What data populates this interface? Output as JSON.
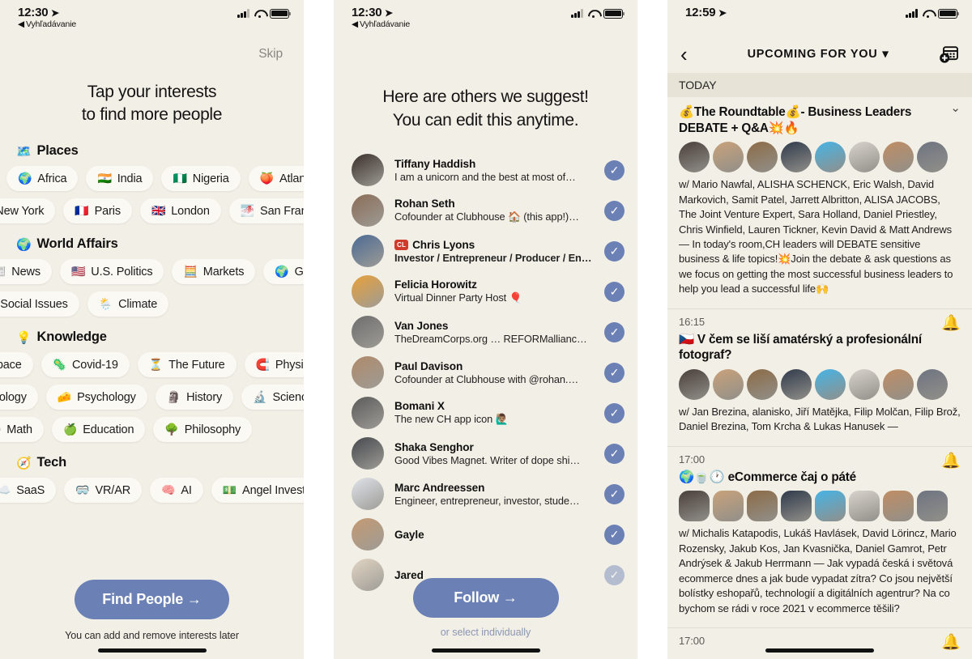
{
  "panel1": {
    "status": {
      "time": "12:30",
      "back_label": "Vyhľadávanie",
      "location_icon": "location-arrow-icon"
    },
    "skip_label": "Skip",
    "headline_line1": "Tap your interests",
    "headline_line2": "to find more people",
    "sections": [
      {
        "emoji": "🗺️",
        "title": "Places",
        "rows": [
          {
            "indent": "ind0",
            "pills": [
              {
                "emoji": "🌍",
                "label": "Africa"
              },
              {
                "emoji": "🇮🇳",
                "label": "India"
              },
              {
                "emoji": "🇳🇬",
                "label": "Nigeria"
              },
              {
                "emoji": "🍑",
                "label": "Atlanta"
              }
            ]
          },
          {
            "indent": "ind2",
            "pills": [
              {
                "emoji": "🗽",
                "label": "New York"
              },
              {
                "emoji": "🇫🇷",
                "label": "Paris"
              },
              {
                "emoji": "🇬🇧",
                "label": "London"
              },
              {
                "emoji": "🌁",
                "label": "San Francisco"
              }
            ]
          }
        ]
      },
      {
        "emoji": "🌍",
        "title": "World Affairs",
        "rows": [
          {
            "indent": "ind5",
            "pills": [
              {
                "emoji": "📰",
                "label": "News"
              },
              {
                "emoji": "🇺🇸",
                "label": "U.S. Politics"
              },
              {
                "emoji": "🧮",
                "label": "Markets"
              },
              {
                "emoji": "🌍",
                "label": "Geopolitics"
              }
            ]
          },
          {
            "indent": "ind6",
            "pills": [
              {
                "emoji": "👥",
                "label": "Social Issues"
              },
              {
                "emoji": "🌦️",
                "label": "Climate"
              }
            ]
          }
        ]
      },
      {
        "emoji": "💡",
        "title": "Knowledge",
        "rows": [
          {
            "indent": "ind4",
            "pills": [
              {
                "emoji": "🚀",
                "label": "Space"
              },
              {
                "emoji": "🦠",
                "label": "Covid-19"
              },
              {
                "emoji": "⏳",
                "label": "The Future"
              },
              {
                "emoji": "🧲",
                "label": "Physics"
              }
            ]
          },
          {
            "indent": "ind4",
            "pills": [
              {
                "emoji": "🧬",
                "label": "Biology"
              },
              {
                "emoji": "🧀",
                "label": "Psychology"
              },
              {
                "emoji": "🗿",
                "label": "History"
              },
              {
                "emoji": "🔬",
                "label": "Science"
              }
            ]
          },
          {
            "indent": "ind3",
            "pills": [
              {
                "emoji": "➗",
                "label": "Math"
              },
              {
                "emoji": "🍏",
                "label": "Education"
              },
              {
                "emoji": "🌳",
                "label": "Philosophy"
              }
            ]
          }
        ]
      },
      {
        "emoji": "🧭",
        "title": "Tech",
        "rows": [
          {
            "indent": "ind1",
            "pills": [
              {
                "emoji": "☁️",
                "label": "SaaS"
              },
              {
                "emoji": "🥽",
                "label": "VR/AR"
              },
              {
                "emoji": "🧠",
                "label": "AI"
              },
              {
                "emoji": "💵",
                "label": "Angel Investing"
              }
            ]
          }
        ]
      }
    ],
    "cta_label": "Find People  →",
    "cta_note": "You can add and remove interests later",
    "accent_color": "#6b80b4",
    "background_color": "#f2efe6"
  },
  "panel2": {
    "status": {
      "time": "12:30",
      "back_label": "Vyhľadávanie",
      "location_icon": "location-arrow-icon"
    },
    "headline_line1": "Here are others we suggest!",
    "headline_line2": "You can edit this anytime.",
    "people": [
      {
        "name": "Tiffany Haddish",
        "bio": "I am a unicorn and the best at most of…",
        "selected": true,
        "badge": "",
        "bold_bio": false,
        "avatar_color": "#3a2f2a"
      },
      {
        "name": "Rohan Seth",
        "bio": "Cofounder at Clubhouse 🏠 (this app!)…",
        "selected": true,
        "badge": "",
        "bold_bio": false,
        "avatar_color": "#8a6c56"
      },
      {
        "name": "Chris Lyons",
        "bio": "Investor / Entrepreneur / Producer / Eng…",
        "selected": true,
        "badge": "CL",
        "bold_bio": true,
        "avatar_color": "#4b6a94"
      },
      {
        "name": "Felicia Horowitz",
        "bio": "Virtual Dinner Party Host 🎈",
        "selected": true,
        "badge": "",
        "bold_bio": false,
        "avatar_color": "#e8a13a"
      },
      {
        "name": "Van Jones",
        "bio": "TheDreamCorps.org … REFORMallianc…",
        "selected": true,
        "badge": "",
        "bold_bio": false,
        "avatar_color": "#6d6d6d"
      },
      {
        "name": "Paul Davison",
        "bio": "Cofounder at Clubhouse with @rohan.…",
        "selected": true,
        "badge": "",
        "bold_bio": false,
        "avatar_color": "#b08a6a"
      },
      {
        "name": "Bomani X",
        "bio": "The new CH app icon 🙋🏽‍♂️",
        "selected": true,
        "badge": "",
        "bold_bio": false,
        "avatar_color": "#5a5a5a"
      },
      {
        "name": "Shaka Senghor",
        "bio": "Good Vibes Magnet. Writer of dope shi…",
        "selected": true,
        "badge": "",
        "bold_bio": false,
        "avatar_color": "#45484d"
      },
      {
        "name": "Marc Andreessen",
        "bio": "Engineer, entrepreneur, investor, stude…",
        "selected": true,
        "badge": "",
        "bold_bio": false,
        "avatar_color": "#dfe3ea"
      },
      {
        "name": "Gayle",
        "bio": "",
        "selected": true,
        "badge": "",
        "bold_bio": false,
        "avatar_color": "#c59a72"
      },
      {
        "name": "Jared",
        "bio": "",
        "selected": true,
        "badge": "",
        "bold_bio": false,
        "avatar_color": "#e3d6c4"
      }
    ],
    "follow_label": "Follow  →",
    "follow_note": "or select individually"
  },
  "panel3": {
    "status": {
      "time": "12:59",
      "location_icon": "location-arrow-icon"
    },
    "nav": {
      "back_icon": "chevron-left-icon",
      "title": "UPCOMING FOR YOU",
      "title_caret": "▾",
      "calendar_icon": "calendar-plus-icon"
    },
    "section_label": "TODAY",
    "events": [
      {
        "time": "",
        "title": "💰The Roundtable💰- Business Leaders DEBATE + Q&A💥🔥",
        "avatar_count": 8,
        "avatar_shape": "round",
        "bell": false,
        "description": "w/ Mario Nawfal, ALISHA SCHENCK, Eric Walsh, David Markovich, Samit Patel, Jarrett Albritton, ALISA JACOBS, The Joint Venture Expert, Sara Holland, Daniel Priestley, Chris Winfield, Lauren Tickner, Kevin David & Matt Andrews — In today's room,CH leaders will DEBATE sensitive business & life topics!💥Join the debate & ask questions as we focus on getting the most successful business leaders to help you lead a successful life🙌"
      },
      {
        "time": "16:15",
        "title": "🇨🇿 V čem se liší amatérský a profesionální fotograf?",
        "avatar_count": 8,
        "avatar_shape": "round",
        "bell": true,
        "description": "w/ Jan Brezina, alanisko, Jiří Matějka, Filip Molčan, Filip Brož, Daniel Brezina, Tom Krcha & Lukas Hanusek —"
      },
      {
        "time": "17:00",
        "title": "🌍🍵🕐 eCommerce čaj o páté",
        "avatar_count": 8,
        "avatar_shape": "rounded",
        "bell": true,
        "description": "w/ Michalis Katapodis, Lukáš Havlásek, David Lörincz, Mario Rozensky, Jakub Kos, Jan Kvasnička, Daniel Gamrot, Petr Andrýsek & Jakub Herrmann — Jak vypadá česká i světová ecommerce dnes a jak bude vypadat zítra? Co jsou největší bolístky eshopařů, technologií a digitálních agentrur? Na co bychom se rádi v roce 2021 v ecommerce těšili?"
      },
      {
        "time": "17:00",
        "title": "",
        "avatar_count": 0,
        "avatar_shape": "round",
        "bell": true,
        "description": ""
      }
    ]
  }
}
